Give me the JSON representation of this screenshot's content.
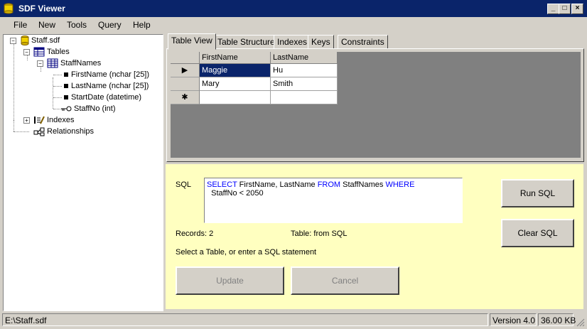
{
  "window": {
    "title": "SDF Viewer",
    "controls": [
      "_",
      "□",
      "×"
    ]
  },
  "menu": {
    "items": [
      "File",
      "New",
      "Tools",
      "Query",
      "Help"
    ]
  },
  "tree": {
    "root": "Staff.sdf",
    "tables_label": "Tables",
    "table_name": "StaffNames",
    "columns": [
      {
        "label": "FirstName (nchar [25])",
        "icon": "column-icon"
      },
      {
        "label": "LastName (nchar [25])",
        "icon": "column-icon"
      },
      {
        "label": "StartDate (datetime)",
        "icon": "column-icon"
      },
      {
        "label": "StaffNo (int)",
        "icon": "key-icon"
      }
    ],
    "indexes_label": "Indexes",
    "relationships_label": "Relationships"
  },
  "tabs": [
    "Table View",
    "Table Structure",
    "Indexes",
    "Keys",
    "Constraints"
  ],
  "grid": {
    "columns": [
      "FirstName",
      "LastName"
    ],
    "rows": [
      {
        "marker": "▶",
        "cells": [
          "Maggie",
          "Hu"
        ]
      },
      {
        "marker": "",
        "cells": [
          "Mary",
          "Smith"
        ]
      },
      {
        "marker": "✱",
        "cells": [
          "",
          ""
        ]
      }
    ]
  },
  "query": {
    "sql_label": "SQL",
    "sql_parts": [
      "SELECT",
      " FirstName, LastName ",
      "FROM",
      " StaffNames ",
      "WHERE",
      "  StaffNo < 2050"
    ],
    "records": "Records: 2",
    "table_info": "Table: from SQL",
    "hint": "Select a Table, or enter a SQL statement",
    "run_button": "Run SQL",
    "clear_button": "Clear SQL",
    "update_button": "Update",
    "cancel_button": "Cancel"
  },
  "status": {
    "path": "E:\\Staff.sdf",
    "version": "Version 4.0",
    "size": "36.00 KB"
  },
  "colors": {
    "titlebar": "#0a246a",
    "panel": "#ffffc0",
    "selection": "#0a246a"
  }
}
